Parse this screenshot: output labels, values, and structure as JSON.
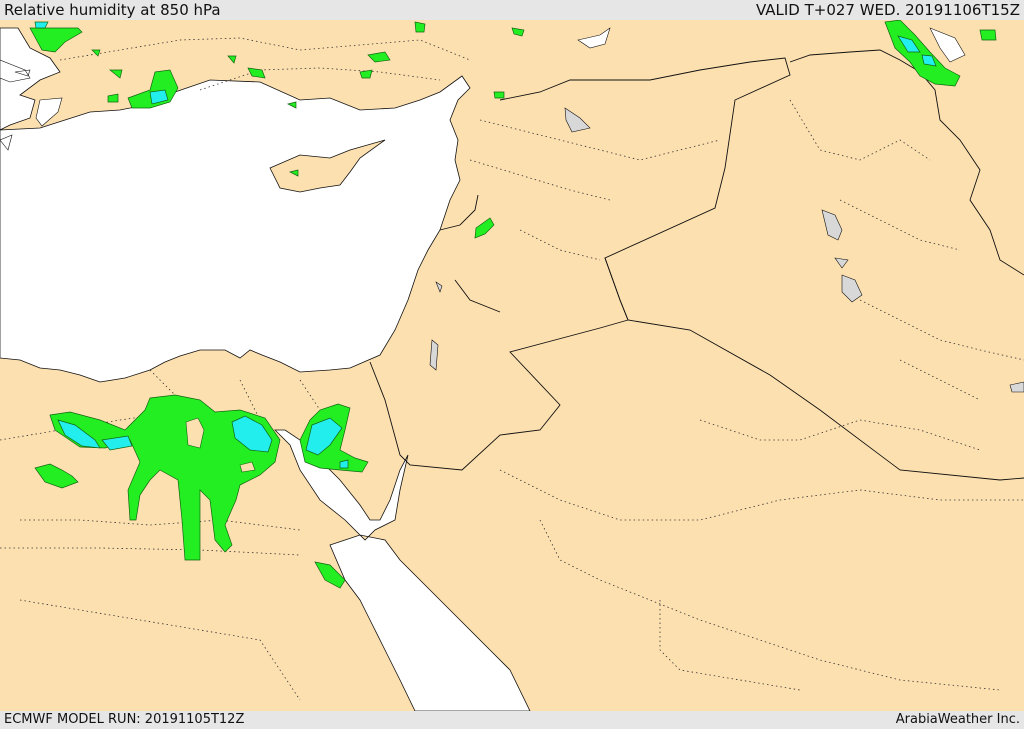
{
  "header": {
    "title": "Relative humidity at 850 hPa",
    "valid": "VALID T+027 WED. 20191106T15Z"
  },
  "footer": {
    "model_run": "ECMWF MODEL RUN: 20191105T12Z",
    "credit": "ArabiaWeather Inc."
  },
  "colors": {
    "land": "#fde0b0",
    "sea": "#ffffff",
    "lake": "#d8d8d8",
    "humidity_high": "#22ee22",
    "humidity_very_high": "#22eeee",
    "border": "#111111"
  },
  "legend_levels": [
    "humidity-high",
    "humidity-very-high"
  ]
}
